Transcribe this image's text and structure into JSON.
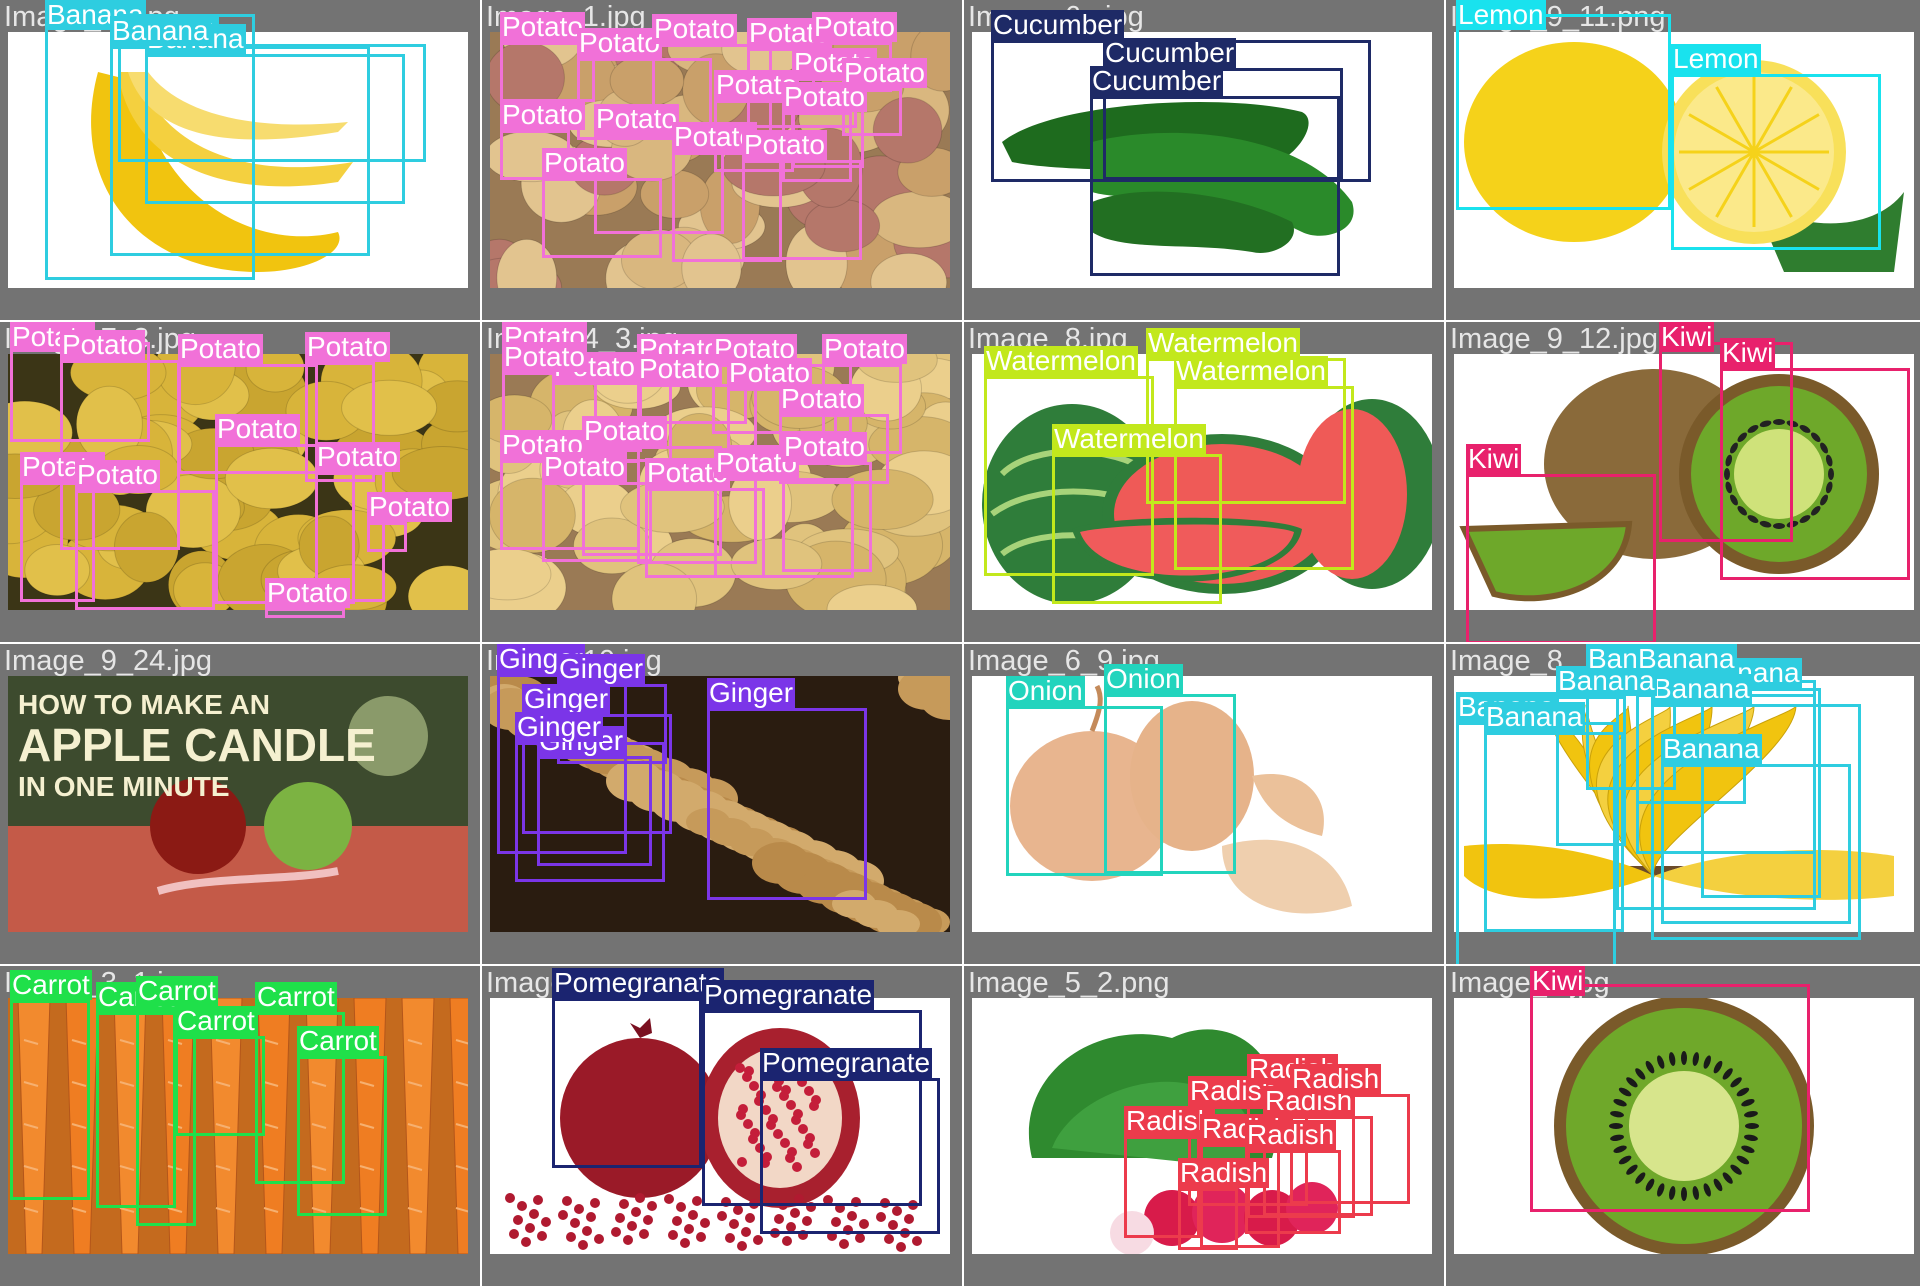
{
  "mosaic": {
    "background": "#737373",
    "class_colors": {
      "Banana": "#2ecde0",
      "Potato": "#f171d8",
      "Cucumber": "#1e2a66",
      "Lemon": "#19e2ee",
      "Watermelon": "#c2e81c",
      "Kiwi": "#e8216c",
      "Ginger": "#7b35e8",
      "Onion": "#22d4bd",
      "Carrot": "#1fe04a",
      "Pomegranate": "#1b2470",
      "Radish": "#ec3b4c"
    },
    "tiles": [
      {
        "filename": "Image_25.jpg",
        "image_subject": "banana",
        "detections": [
          {
            "label": "Banana"
          },
          {
            "label": "Banana"
          },
          {
            "label": "Banana"
          },
          {
            "label": "Banana"
          }
        ]
      },
      {
        "filename": "Image_1.jpg",
        "image_subject": "potatoes",
        "detections": [
          {
            "label": "Potato"
          },
          {
            "label": "Potato"
          },
          {
            "label": "Potato"
          },
          {
            "label": "Potato"
          },
          {
            "label": "Potato"
          },
          {
            "label": "Potato"
          },
          {
            "label": "Potato"
          },
          {
            "label": "Potato"
          },
          {
            "label": "Potato"
          },
          {
            "label": "Potato"
          },
          {
            "label": "Potato"
          },
          {
            "label": "Potato"
          },
          {
            "label": "Potato"
          },
          {
            "label": "Potato"
          }
        ]
      },
      {
        "filename": "Image_6_.jpg",
        "image_subject": "cucumber",
        "detections": [
          {
            "label": "Cucumber"
          },
          {
            "label": "Cucumber"
          },
          {
            "label": "Cucumber"
          }
        ]
      },
      {
        "filename": "Image_9_11.png",
        "image_subject": "lemon",
        "detections": [
          {
            "label": "Lemon"
          },
          {
            "label": "Lemon"
          }
        ]
      },
      {
        "filename": "Image_7_3.jpg",
        "image_subject": "potatoes",
        "detections": [
          {
            "label": "Potato"
          },
          {
            "label": "Potato"
          },
          {
            "label": "Potato"
          },
          {
            "label": "Potato"
          },
          {
            "label": "Potato"
          },
          {
            "label": "Potato"
          },
          {
            "label": "Potato"
          },
          {
            "label": "Potato"
          },
          {
            "label": "Potato"
          },
          {
            "label": "Potato"
          }
        ]
      },
      {
        "filename": "Image_4_3.jpg",
        "image_subject": "potatoes",
        "detections": [
          {
            "label": "Potato"
          },
          {
            "label": "Potato"
          },
          {
            "label": "Potato"
          },
          {
            "label": "Potato"
          },
          {
            "label": "Potato"
          },
          {
            "label": "Potato"
          },
          {
            "label": "Potato"
          },
          {
            "label": "Potato"
          },
          {
            "label": "Potato"
          },
          {
            "label": "Potato"
          },
          {
            "label": "Potato"
          },
          {
            "label": "Potato"
          },
          {
            "label": "Potato"
          },
          {
            "label": "Potato"
          },
          {
            "label": "Potato"
          }
        ]
      },
      {
        "filename": "Image_8.jpg",
        "image_subject": "watermelon",
        "detections": [
          {
            "label": "Watermelon"
          },
          {
            "label": "Watermelon"
          },
          {
            "label": "Watermelon"
          },
          {
            "label": "Watermelon"
          }
        ]
      },
      {
        "filename": "Image_9_12.jpg",
        "image_subject": "kiwi",
        "detections": [
          {
            "label": "Kiwi"
          },
          {
            "label": "Kiwi"
          },
          {
            "label": "Kiwi"
          }
        ]
      },
      {
        "filename": "Image_9_24.jpg",
        "image_subject": "apple candle",
        "overlay_text": [
          "HOW TO MAKE AN",
          "APPLE CANDLE",
          "IN ONE MINUTE"
        ],
        "detections": []
      },
      {
        "filename": "Image_10.jpg",
        "image_subject": "ginger",
        "detections": [
          {
            "label": "Ginger"
          },
          {
            "label": "Ginger"
          },
          {
            "label": "Ginger"
          },
          {
            "label": "Ginger"
          },
          {
            "label": "Ginger"
          },
          {
            "label": "Ginger"
          }
        ]
      },
      {
        "filename": "Image_6_9.jpg",
        "image_subject": "onion",
        "detections": [
          {
            "label": "Onion"
          },
          {
            "label": "Onion"
          }
        ]
      },
      {
        "filename": "Image_8_.jpg",
        "image_subject": "banana",
        "detections": [
          {
            "label": "Banana"
          },
          {
            "label": "Banana"
          },
          {
            "label": "Banana"
          },
          {
            "label": "Banana"
          },
          {
            "label": "Banana"
          },
          {
            "label": "Banana"
          },
          {
            "label": "Banana"
          },
          {
            "label": "Banana"
          },
          {
            "label": "Banana"
          },
          {
            "label": "Banana"
          }
        ]
      },
      {
        "filename": "Image_3_1.jpg",
        "image_subject": "carrot",
        "detections": [
          {
            "label": "Carrot"
          },
          {
            "label": "Carrot"
          },
          {
            "label": "Carrot"
          },
          {
            "label": "Carrot"
          },
          {
            "label": "Carrot"
          },
          {
            "label": "Carrot"
          }
        ]
      },
      {
        "filename": "Image_6_4.jpg",
        "image_subject": "pomegranate",
        "detections": [
          {
            "label": "Pomegranate"
          },
          {
            "label": "Pomegranate"
          },
          {
            "label": "Pomegranate"
          }
        ]
      },
      {
        "filename": "Image_5_2.png",
        "image_subject": "radish",
        "detections": [
          {
            "label": "Radish"
          },
          {
            "label": "Radish"
          },
          {
            "label": "Radish"
          },
          {
            "label": "Radish"
          },
          {
            "label": "Radish"
          },
          {
            "label": "Radish"
          },
          {
            "label": "Radish"
          },
          {
            "label": "Radish"
          }
        ]
      },
      {
        "filename": "Image_3.jpg",
        "image_subject": "kiwi",
        "detections": [
          {
            "label": "Kiwi"
          }
        ]
      }
    ]
  }
}
